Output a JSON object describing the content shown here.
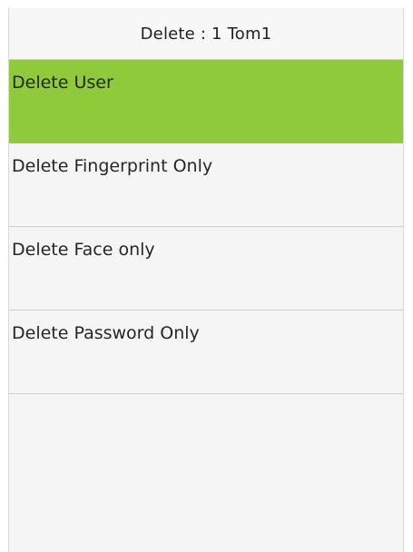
{
  "header": {
    "title": "Delete : 1 Tom1"
  },
  "menu": {
    "items": [
      {
        "label": "Delete User",
        "selected": true
      },
      {
        "label": "Delete Fingerprint Only",
        "selected": false
      },
      {
        "label": "Delete Face only",
        "selected": false
      },
      {
        "label": "Delete Password Only",
        "selected": false
      }
    ]
  },
  "colors": {
    "selected_background": "#8fca3a",
    "background": "#f5f5f5",
    "divider": "#cfcfcf"
  }
}
